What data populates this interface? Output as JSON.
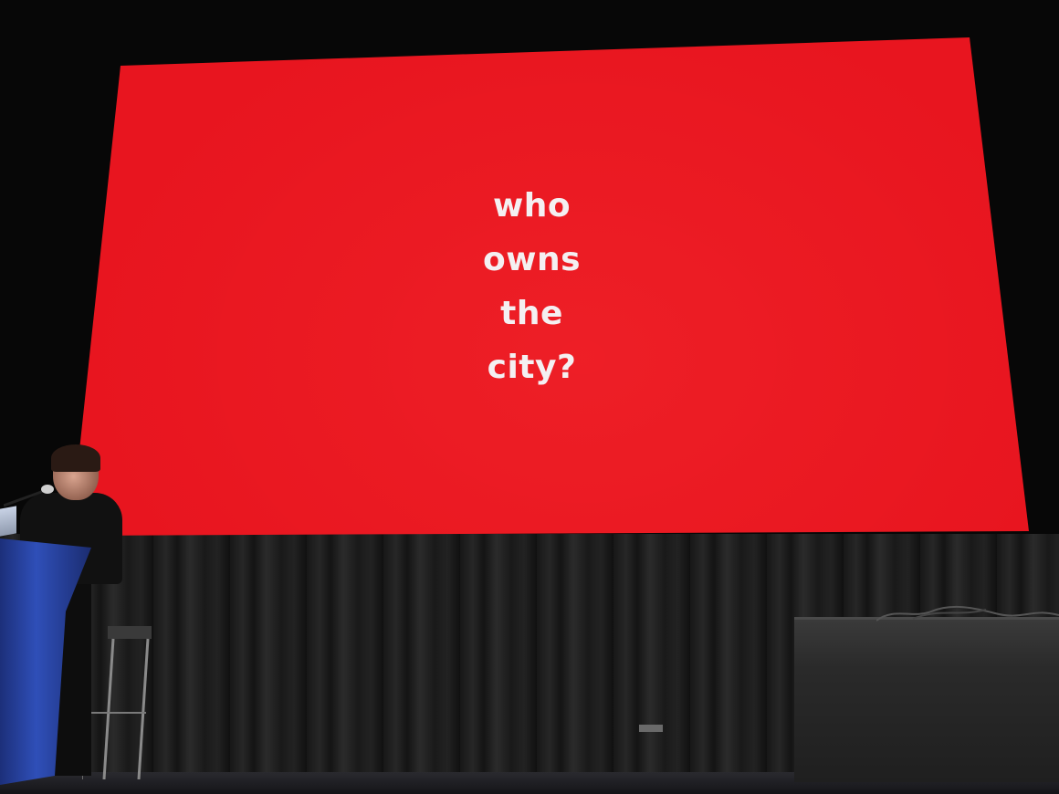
{
  "slide": {
    "lines": [
      "who",
      "owns",
      "the",
      "city?"
    ],
    "background_color": "#e8151f",
    "text_color": "#f4f0f2"
  },
  "scene": {
    "stage_color": "#070707",
    "curtain_color": "#222222",
    "podium_color": "#2f4fb8",
    "table_cloth_color": "#2a2a2a"
  }
}
